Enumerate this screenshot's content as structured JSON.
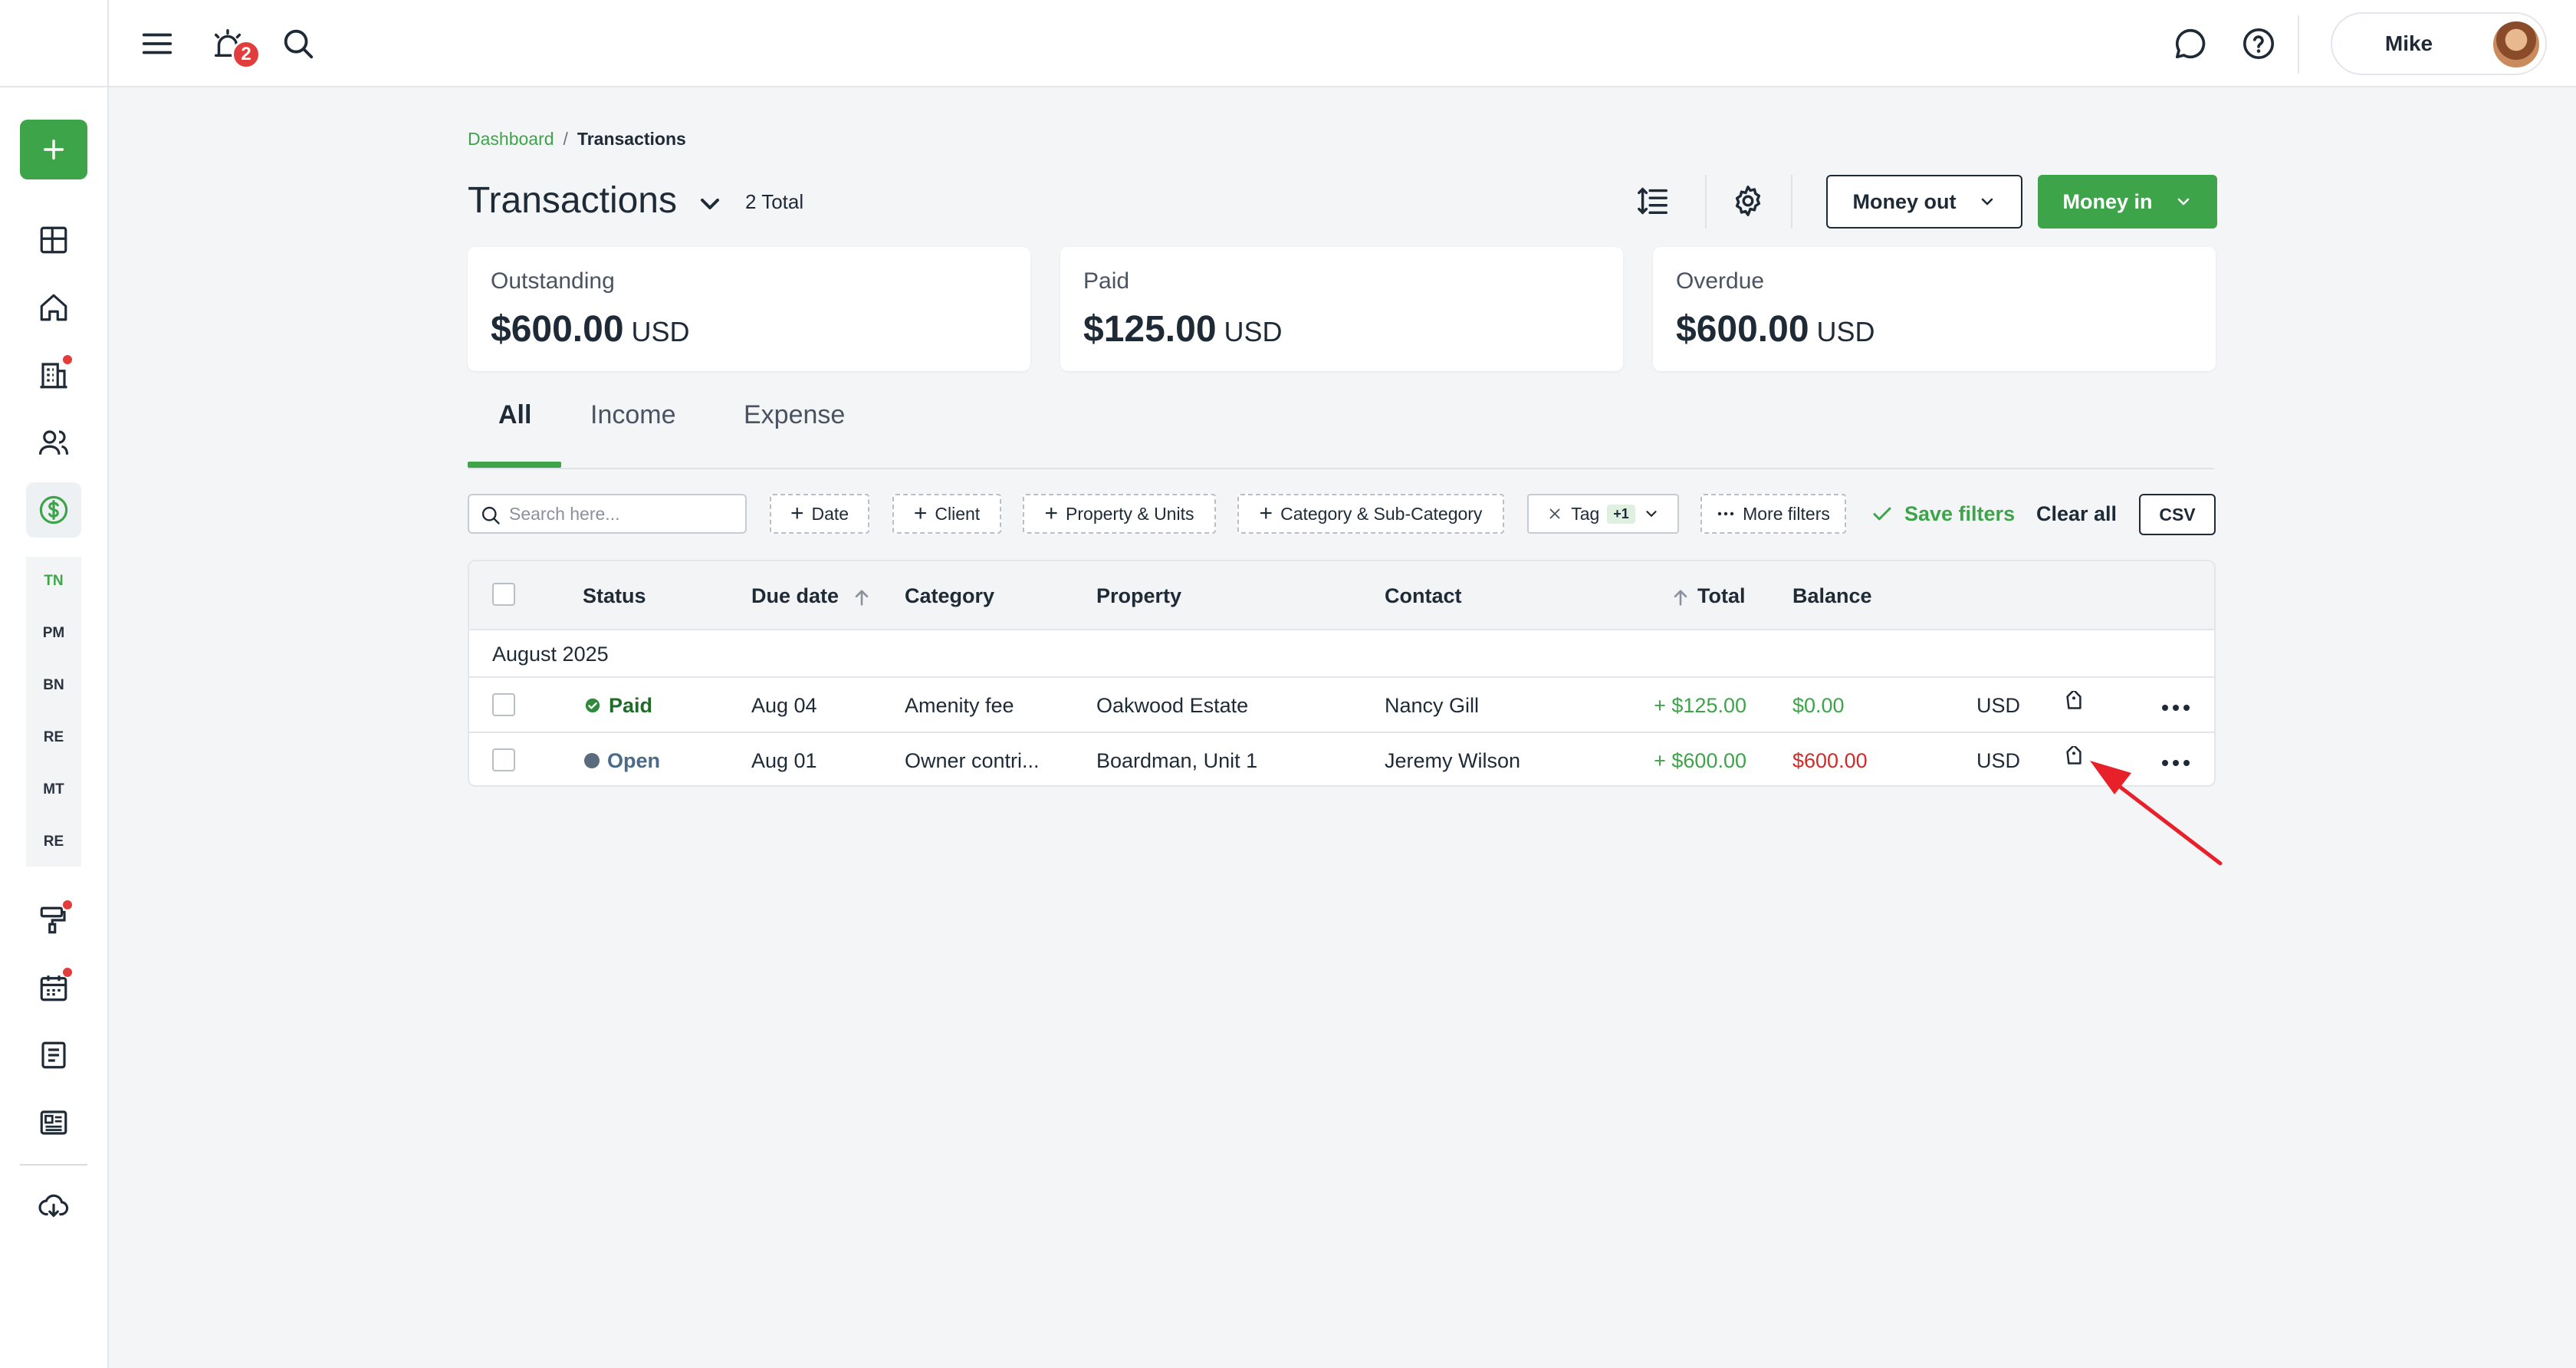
{
  "topbar": {
    "notification_count": "2",
    "user_name": "Mike"
  },
  "sidebar": {
    "short_links": [
      "TN",
      "PM",
      "BN",
      "RE",
      "MT",
      "RE"
    ]
  },
  "breadcrumb": {
    "parent": "Dashboard",
    "separator": "/",
    "current": "Transactions"
  },
  "header": {
    "title": "Transactions",
    "total": "2 Total",
    "money_out_label": "Money out",
    "money_in_label": "Money in"
  },
  "stats": [
    {
      "label": "Outstanding",
      "value": "$600.00",
      "currency": "USD"
    },
    {
      "label": "Paid",
      "value": "$125.00",
      "currency": "USD"
    },
    {
      "label": "Overdue",
      "value": "$600.00",
      "currency": "USD"
    }
  ],
  "tabs": [
    "All",
    "Income",
    "Expense"
  ],
  "filters": {
    "search_placeholder": "Search here...",
    "date": "Date",
    "client": "Client",
    "property_units": "Property & Units",
    "category": "Category & Sub-Category",
    "tag": "Tag",
    "tag_extra": "+1",
    "more_filters": "More filters",
    "save_filters": "Save filters",
    "clear_all": "Clear all",
    "csv": "CSV"
  },
  "table": {
    "columns": {
      "status": "Status",
      "due_date": "Due date",
      "category": "Category",
      "property": "Property",
      "contact": "Contact",
      "total": "Total",
      "balance": "Balance"
    },
    "group": "August 2025",
    "rows": [
      {
        "status": "Paid",
        "due_date": "Aug 04",
        "category": "Amenity fee",
        "property": "Oakwood Estate",
        "contact": "Nancy Gill",
        "total": "+ $125.00",
        "balance": "$0.00",
        "currency": "USD"
      },
      {
        "status": "Open",
        "due_date": "Aug 01",
        "category": "Owner contri...",
        "property": "Boardman, Unit 1",
        "contact": "Jeremy Wilson",
        "total": "+ $600.00",
        "balance": "$600.00",
        "currency": "USD"
      }
    ]
  },
  "colors": {
    "accent": "#3ea44a",
    "negative": "#d02b2b",
    "annotation_arrow": "#e8202a"
  }
}
